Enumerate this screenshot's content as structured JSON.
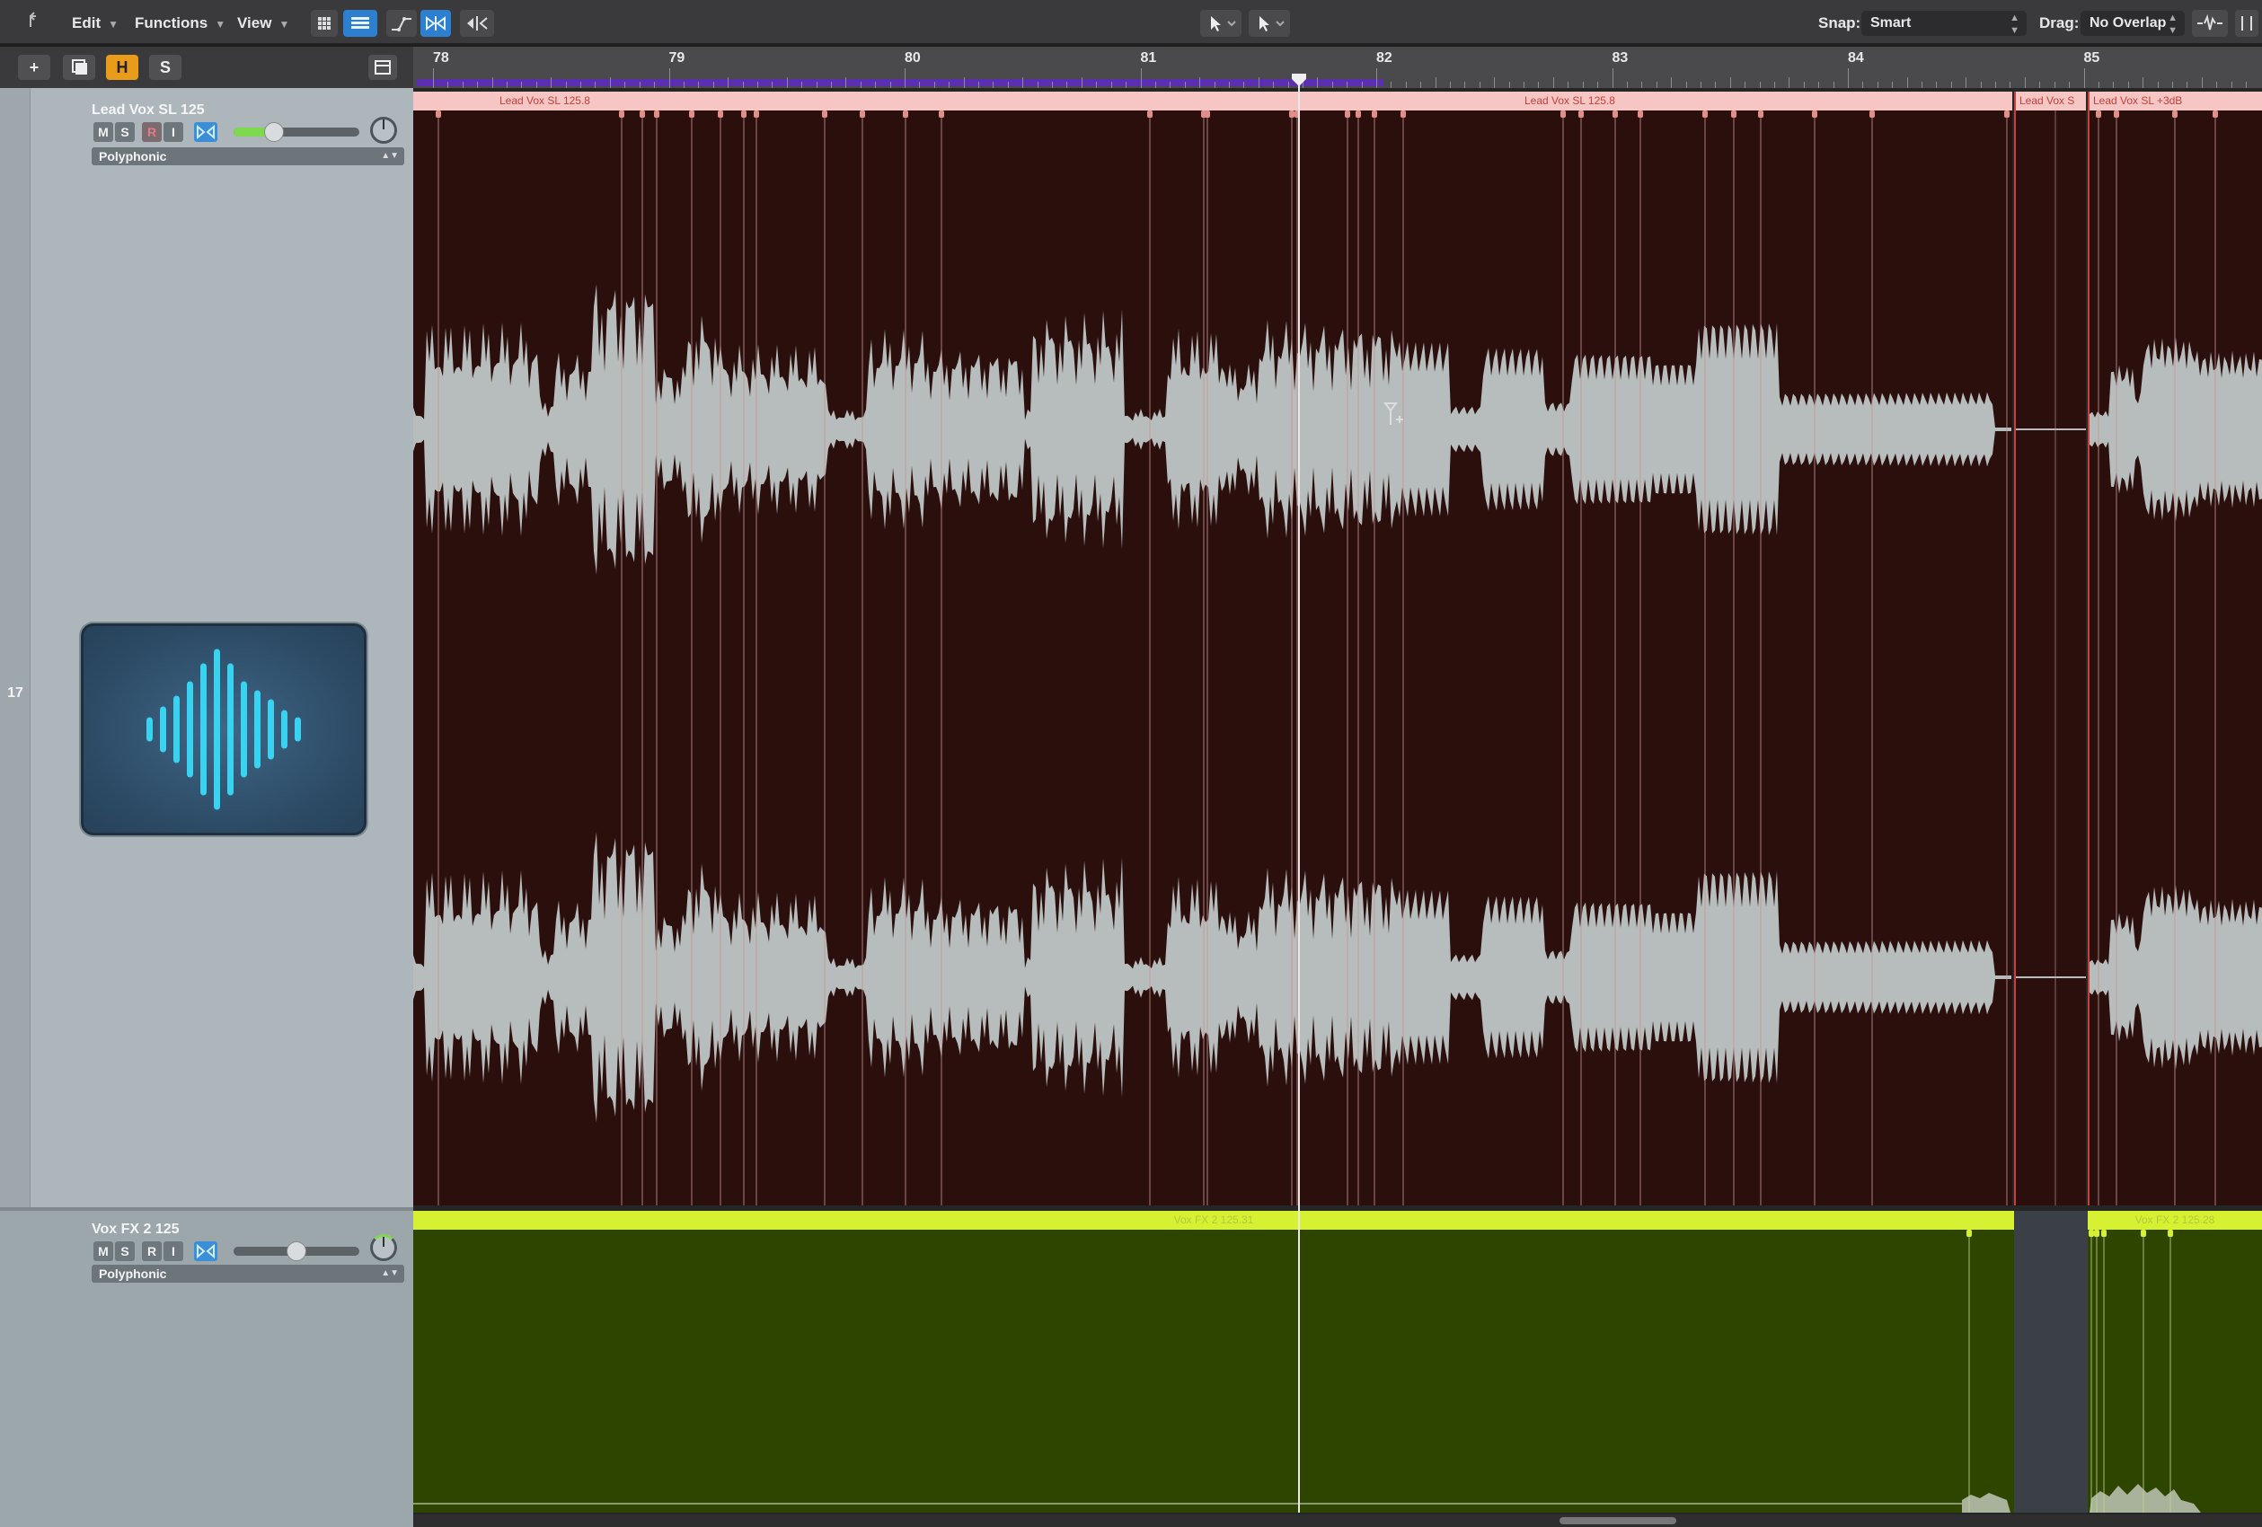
{
  "toolbar": {
    "edit_label": "Edit",
    "functions_label": "Functions",
    "view_label": "View",
    "snap_label": "Snap:",
    "snap_value": "Smart",
    "drag_label": "Drag:",
    "drag_value": "No Overlap"
  },
  "header_buttons": {
    "add": "+",
    "hide": "H",
    "solo": "S"
  },
  "lane_number": "17",
  "tracks": [
    {
      "name": "Lead Vox SL 125",
      "mute": "M",
      "solo": "S",
      "record": "R",
      "input": "I",
      "flex_mode": "Polyphonic",
      "volume_fraction": 0.32,
      "color": "#f6c6c5"
    },
    {
      "name": "Vox FX 2 125",
      "mute": "M",
      "solo": "S",
      "record": "R",
      "input": "I",
      "flex_mode": "Polyphonic",
      "volume_fraction": 0.5,
      "color": "#d6f131"
    }
  ],
  "ruler": {
    "bars": [
      "78",
      "79",
      "80",
      "81",
      "82",
      "83",
      "84",
      "85"
    ]
  },
  "regions": {
    "lead_a": "Lead Vox SL 125.8",
    "lead_b": "Lead Vox SL 125.8",
    "lead_c": "Lead Vox S",
    "lead_d": "Lead Vox SL +3dB",
    "fx_a": "Vox FX 2 125.31",
    "fx_b": "Vox FX 2 125.28"
  }
}
